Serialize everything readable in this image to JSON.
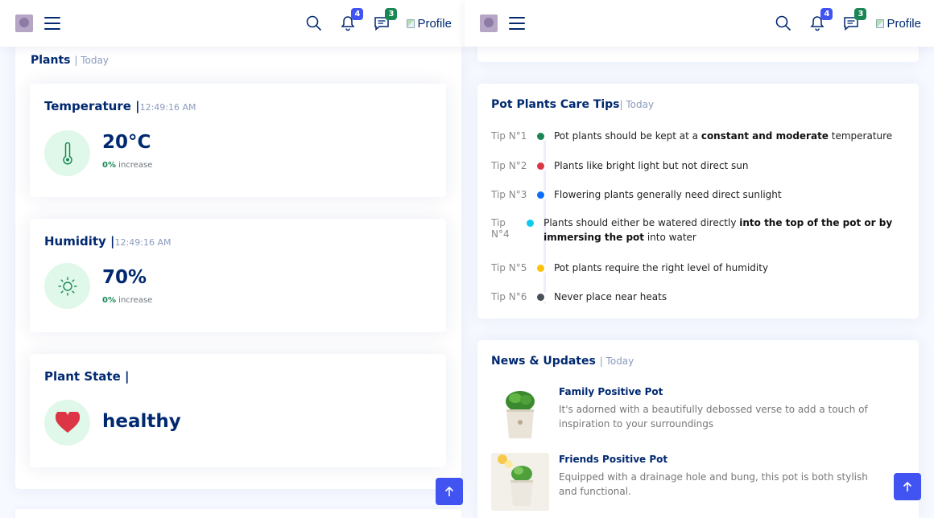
{
  "header": {
    "notifications_count": "4",
    "messages_count": "3",
    "profile_alt": "Profile"
  },
  "plants": {
    "section_title": "Plants",
    "section_suffix": "| Today",
    "temperature": {
      "title": "Temperature |",
      "time": "12:49:16 AM",
      "value": "20°C",
      "change": "0%",
      "change_label": "increase"
    },
    "humidity": {
      "title": "Humidity |",
      "time": "12:49:16 AM",
      "value": "70%",
      "change": "0%",
      "change_label": "increase"
    },
    "state": {
      "title": "Plant State |",
      "value": "healthy"
    }
  },
  "tips": {
    "title": "Pot Plants Care Tips",
    "suffix": "| Today",
    "items": [
      {
        "label": "Tip N°1",
        "color": "#198754",
        "pre": "Pot plants should be kept at a ",
        "bold": "constant and moderate",
        "post": " temperature"
      },
      {
        "label": "Tip N°2",
        "color": "#dc3545",
        "pre": "Plants like bright light but not direct sun",
        "bold": "",
        "post": ""
      },
      {
        "label": "Tip N°3",
        "color": "#0d6efd",
        "pre": "Flowering plants generally need direct sunlight",
        "bold": "",
        "post": ""
      },
      {
        "label": "Tip N°4",
        "color": "#0dcaf0",
        "pre": "Plants should either be watered directly ",
        "bold": "into the top of the pot or by immersing the pot",
        "post": " into water"
      },
      {
        "label": "Tip N°5",
        "color": "#ffc107",
        "pre": "Pot plants require the right level of humidity",
        "bold": "",
        "post": ""
      },
      {
        "label": "Tip N°6",
        "color": "#495057",
        "pre": "Never place near heats",
        "bold": "",
        "post": ""
      }
    ]
  },
  "news": {
    "title": "News & Updates",
    "suffix": "| Today",
    "items": [
      {
        "title": "Family Positive Pot",
        "desc": "It's adorned with a beautifully debossed verse to add a touch of inspiration to your surroundings"
      },
      {
        "title": "Friends Positive Pot",
        "desc": "Equipped with a drainage hole and bung, this pot is both stylish and functional."
      }
    ]
  },
  "colors": {
    "accent": "#4154f1",
    "navy": "#012970",
    "green": "#198754",
    "heart": "#dc3545"
  }
}
